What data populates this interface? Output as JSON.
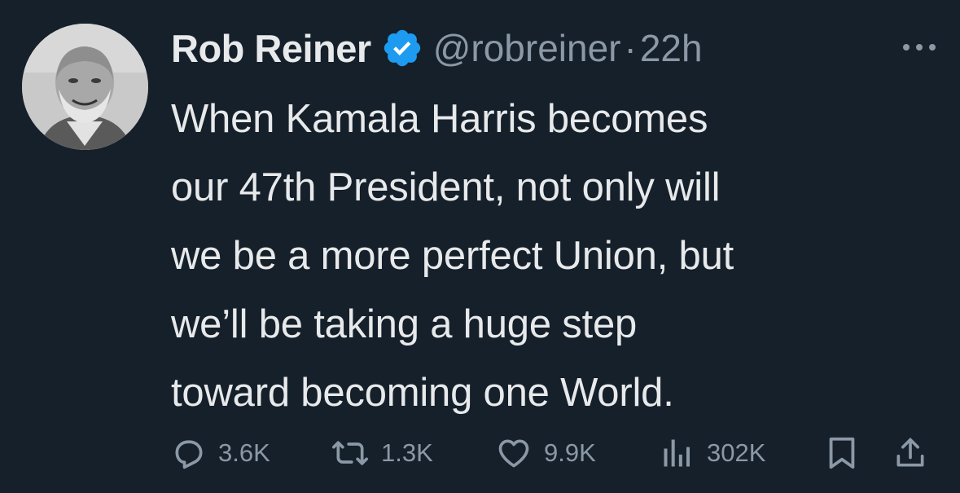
{
  "author": {
    "display_name": "Rob Reiner",
    "handle": "@robreiner",
    "separator": "·",
    "time": "22h",
    "verified": true,
    "verified_color": "#1d9bf0"
  },
  "tweet": {
    "lines": [
      "When Kamala Harris becomes",
      "our 47th President, not only will",
      "we be a more perfect Union, but",
      "we’ll be taking a huge step",
      "toward becoming one World."
    ]
  },
  "actions": {
    "replies": "3.6K",
    "reposts": "1.3K",
    "likes": "9.9K",
    "views": "302K"
  },
  "icons": {
    "more": "ellipsis-icon",
    "reply": "reply-icon",
    "repost": "repost-icon",
    "like": "heart-icon",
    "views": "views-chart-icon",
    "bookmark": "bookmark-icon",
    "share": "share-icon"
  },
  "colors": {
    "background": "#15202b",
    "text": "#e7e9ea",
    "secondary": "#8b98a5"
  }
}
